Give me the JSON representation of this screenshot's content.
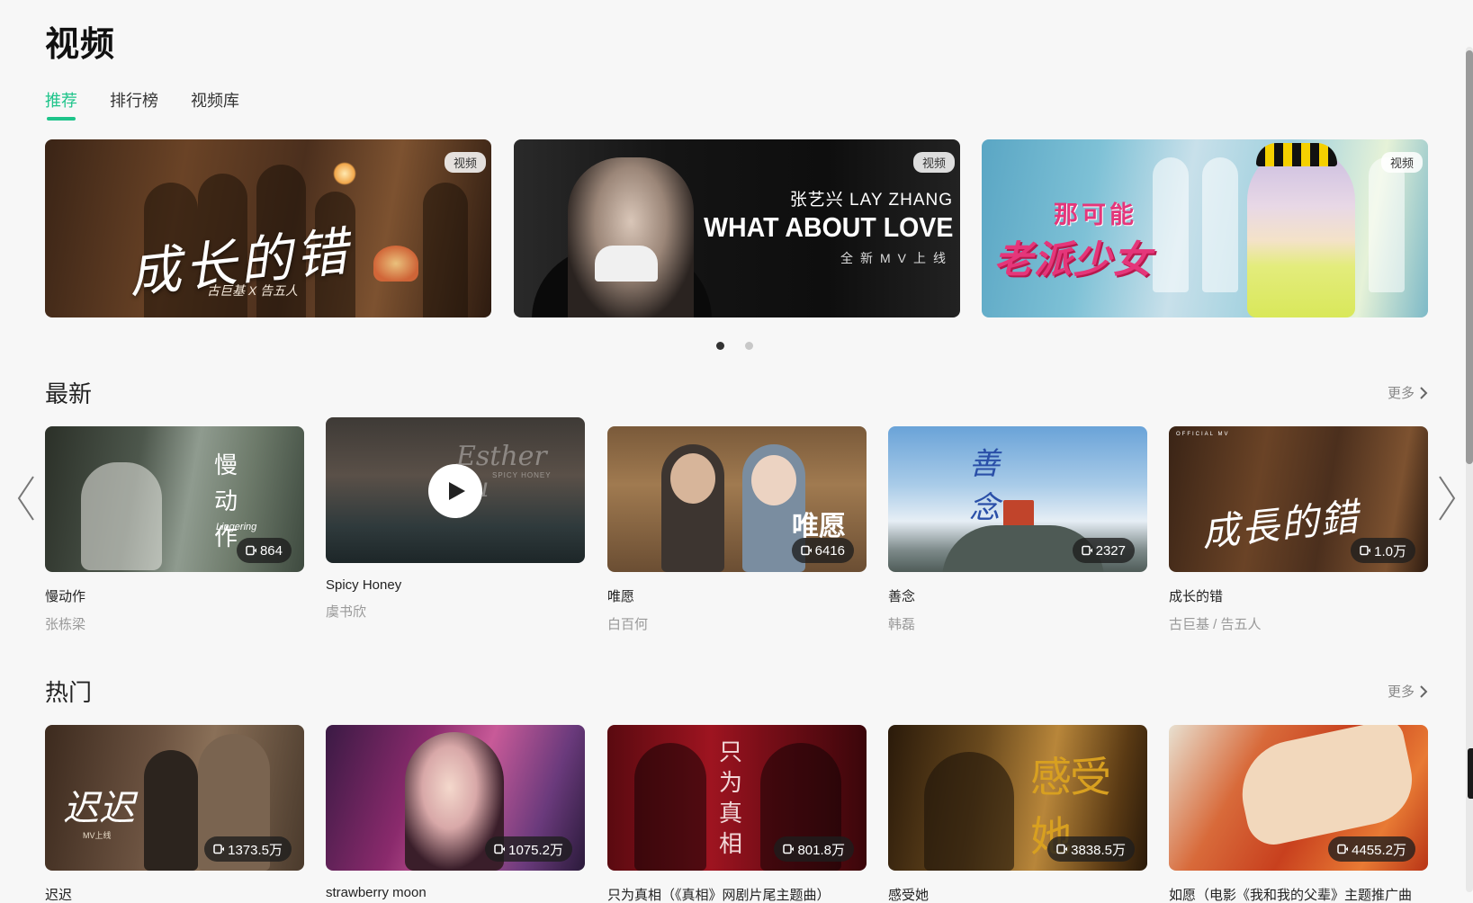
{
  "page": {
    "title": "视频"
  },
  "tabs": [
    {
      "label": "推荐",
      "active": true
    },
    {
      "label": "排行榜",
      "active": false
    },
    {
      "label": "视频库",
      "active": false
    }
  ],
  "banners": [
    {
      "tag": "视频",
      "title": "成长的错",
      "subtitle": "古巨基 X 告五人"
    },
    {
      "tag": "视频",
      "line1": "张艺兴 LAY ZHANG",
      "line2": "WHAT ABOUT LOVE",
      "line3": "全新MV上线"
    },
    {
      "tag": "视频",
      "line1": "那可能",
      "line2": "老派少女"
    }
  ],
  "carousel": {
    "pages": 2,
    "active_index": 0
  },
  "latest": {
    "title": "最新",
    "more": "更多",
    "items": [
      {
        "title": "慢动作",
        "artist": "张栋梁",
        "plays": "864",
        "thumb_text": "慢 动 作",
        "thumb_sub": "Lingering"
      },
      {
        "title": "Spicy Honey",
        "artist": "虞书欣",
        "plays": "",
        "thumb_text": "Esther Yu",
        "thumb_sub": "SPICY HONEY"
      },
      {
        "title": "唯愿",
        "artist": "白百何",
        "plays": "6416",
        "thumb_text": "唯愿"
      },
      {
        "title": "善念",
        "artist": "韩磊",
        "plays": "2327",
        "thumb_text": "善 念"
      },
      {
        "title": "成长的错",
        "artist": "古巨基 / 告五人",
        "plays": "1.0万",
        "thumb_text": "成長的錯",
        "thumb_sub": "OFFICIAL MV"
      }
    ]
  },
  "hot": {
    "title": "热门",
    "more": "更多",
    "items": [
      {
        "title": "迟迟",
        "plays": "1373.5万",
        "thumb_text": "迟迟",
        "thumb_sub": "MV上线"
      },
      {
        "title": "strawberry moon",
        "plays": "1075.2万"
      },
      {
        "title": "只为真相（《真相》网剧片尾主题曲）",
        "plays": "801.8万",
        "thumb_text": "只为真相"
      },
      {
        "title": "感受她",
        "plays": "3838.5万",
        "thumb_text": "感受她"
      },
      {
        "title": "如愿（电影《我和我的父辈》主题推广曲",
        "plays": "4455.2万"
      }
    ]
  },
  "colors": {
    "accent": "#1ec48a",
    "background": "#f7f7f7"
  }
}
